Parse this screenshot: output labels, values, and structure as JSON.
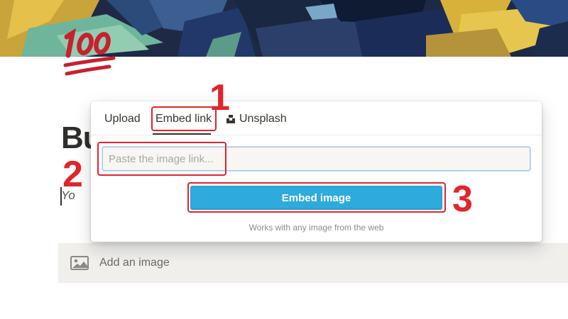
{
  "page": {
    "title": "Bu",
    "subtitle": "Yo"
  },
  "popup": {
    "tabs": [
      {
        "label": "Upload"
      },
      {
        "label": "Embed link"
      },
      {
        "label": "Unsplash"
      }
    ],
    "active_tab": "Embed link",
    "link_input": {
      "placeholder": "Paste the image link...",
      "value": ""
    },
    "embed_button_label": "Embed image",
    "hint_text": "Works with any image from the web"
  },
  "add_image": {
    "label": "Add an image",
    "icon": "image-icon"
  },
  "annotations": {
    "step1": "1",
    "step2": "2",
    "step3": "3"
  },
  "colors": {
    "accent_button": "#2eaadc",
    "annotation_red": "#e2242b",
    "emoji_red": "#c7202f"
  }
}
